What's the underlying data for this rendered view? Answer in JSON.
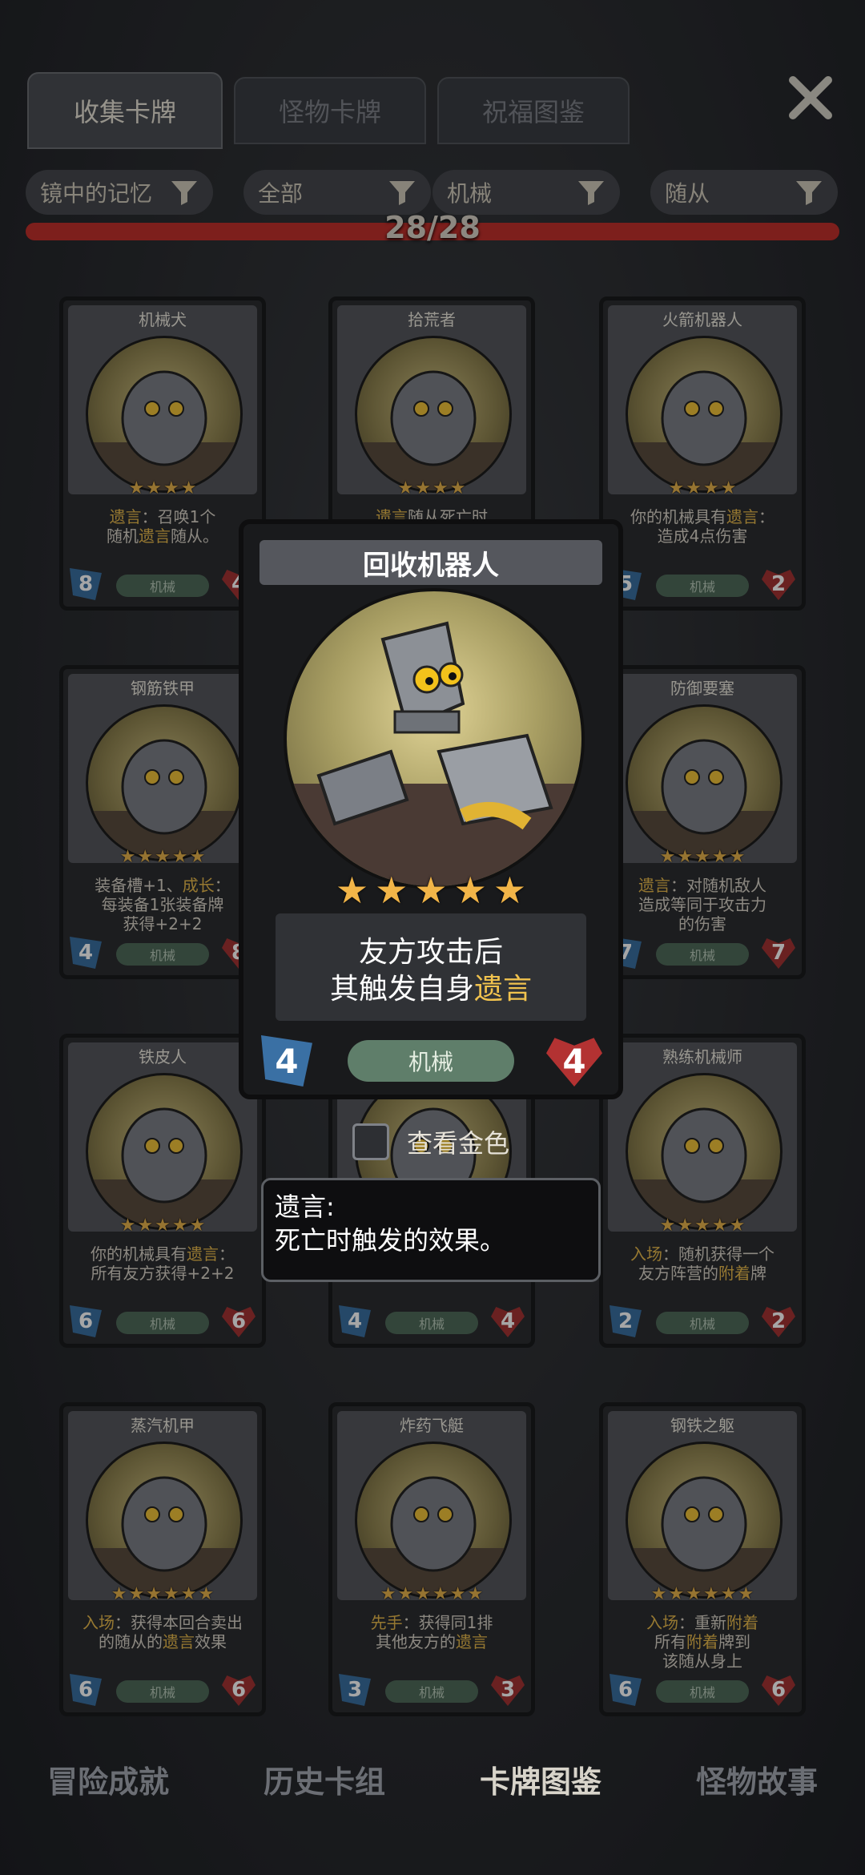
{
  "tabs": [
    {
      "label": "收集卡牌",
      "active": true
    },
    {
      "label": "怪物卡牌",
      "active": false
    },
    {
      "label": "祝福图鉴",
      "active": false
    }
  ],
  "close_icon": "close-x-icon",
  "filters": [
    {
      "label": "镜中的记忆",
      "icon": "funnel-icon"
    },
    {
      "label": "全部",
      "icon": "funnel-icon"
    },
    {
      "label": "机械",
      "icon": "funnel-icon"
    },
    {
      "label": "随从",
      "icon": "funnel-icon"
    }
  ],
  "progress": {
    "text": "28/28",
    "fraction": 1.0
  },
  "cards": [
    {
      "name": "机械犬",
      "stars": 4,
      "desc_html": "<span class='kw'>遗言</span>：召唤1个<br>随机<span class='kw'>遗言</span>随从。",
      "cost": "8",
      "hp": "4",
      "tag": "机械"
    },
    {
      "name": "拾荒者",
      "stars": 4,
      "desc_html": "<span class='kw'>遗言</span>随从死亡时",
      "cost": "",
      "hp": "",
      "tag": "机械"
    },
    {
      "name": "火箭机器人",
      "stars": 4,
      "desc_html": "你的机械具有<span class='kw'>遗言</span>：<br>造成4点伤害",
      "cost": "5",
      "hp": "2",
      "tag": "机械"
    },
    {
      "name": "钢筋铁甲",
      "stars": 5,
      "desc_html": "装备槽+1、<span class='kw'>成长</span>：<br>每装备1张装备牌<br>获得+2+2",
      "cost": "4",
      "hp": "8",
      "tag": "机械"
    },
    {
      "name": "回收机器人",
      "stars": 5,
      "desc_html": "",
      "cost": "",
      "hp": "",
      "tag": "机械"
    },
    {
      "name": "防御要塞",
      "stars": 5,
      "desc_html": "<span class='kw'>遗言</span>：对随机敌人<br>造成等同于攻击力<br>的伤害",
      "cost": "7",
      "hp": "7",
      "tag": "机械"
    },
    {
      "name": "铁皮人",
      "stars": 5,
      "desc_html": "你的机械具有<span class='kw'>遗言</span>：<br>所有友方获得+2+2",
      "cost": "6",
      "hp": "6",
      "tag": "机械"
    },
    {
      "name": "",
      "stars": 5,
      "desc_html": "其触发自身<span class='kw'>遗言</span>",
      "cost": "4",
      "hp": "4",
      "tag": "机械"
    },
    {
      "name": "熟练机械师",
      "stars": 5,
      "desc_html": "<span class='kw'>入场</span>：随机获得一个<br>友方阵营的<span class='kw'>附着</span>牌",
      "cost": "2",
      "hp": "2",
      "tag": "机械"
    },
    {
      "name": "蒸汽机甲",
      "stars": 6,
      "desc_html": "<span class='kw'>入场</span>：获得本回合卖出<br>的随从的<span class='kw'>遗言</span>效果",
      "cost": "6",
      "hp": "6",
      "tag": "机械"
    },
    {
      "name": "炸药飞艇",
      "stars": 6,
      "desc_html": "<span class='kw'>先手</span>：获得同1排<br>其他友方的<span class='kw'>遗言</span>",
      "cost": "3",
      "hp": "3",
      "tag": "机械"
    },
    {
      "name": "钢铁之躯",
      "stars": 6,
      "desc_html": "<span class='kw'>入场</span>：重新<span class='kw'>附着</span><br>所有<span class='kw'>附着</span>牌到<br>该随从身上",
      "cost": "6",
      "hp": "6",
      "tag": "机械"
    }
  ],
  "detail_card": {
    "name": "回收机器人",
    "stars": 5,
    "desc_line1": "友方攻击后",
    "desc_line2_prefix": "其触发自身",
    "desc_line2_keyword": "遗言",
    "cost": "4",
    "hp": "4",
    "tag": "机械"
  },
  "gold_toggle": {
    "label": "查看金色",
    "checked": false
  },
  "tooltip": {
    "title": "遗言:",
    "body": "死亡时触发的效果。"
  },
  "bottom_nav": [
    {
      "label": "冒险成就",
      "active": false
    },
    {
      "label": "历史卡组",
      "active": false
    },
    {
      "label": "卡牌图鉴",
      "active": true
    },
    {
      "label": "怪物故事",
      "active": false
    }
  ],
  "colors": {
    "keyword": "#e7b94c",
    "progress": "#c0302c",
    "tag": "#4f6b59"
  }
}
